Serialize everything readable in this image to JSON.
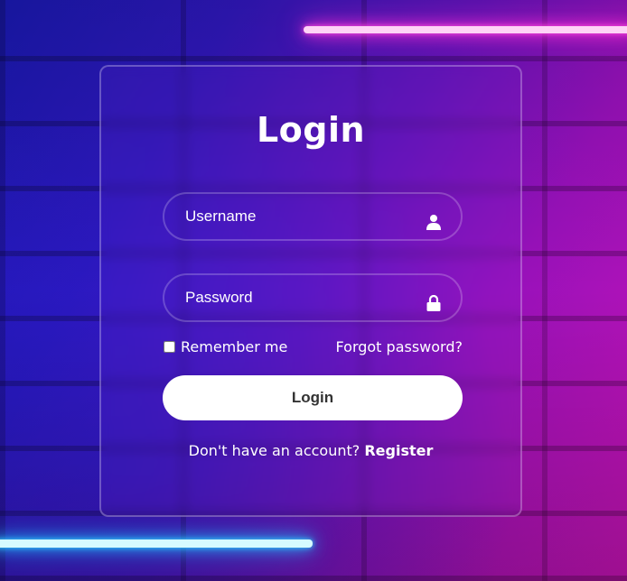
{
  "form": {
    "title": "Login",
    "username": {
      "placeholder": "Username",
      "icon": "user-icon"
    },
    "password": {
      "placeholder": "Password",
      "icon": "lock-icon"
    },
    "remember_label": "Remember me",
    "forgot_label": "Forgot password?",
    "submit_label": "Login",
    "register_prompt": "Don't have an account?",
    "register_link": "Register"
  },
  "colors": {
    "gradient_left": "#1a1ab8",
    "gradient_right": "#d414c0",
    "neon_pink": "#ff2fd6",
    "neon_blue": "#1fb4ff",
    "button_bg": "#ffffff",
    "button_text": "#333333"
  }
}
